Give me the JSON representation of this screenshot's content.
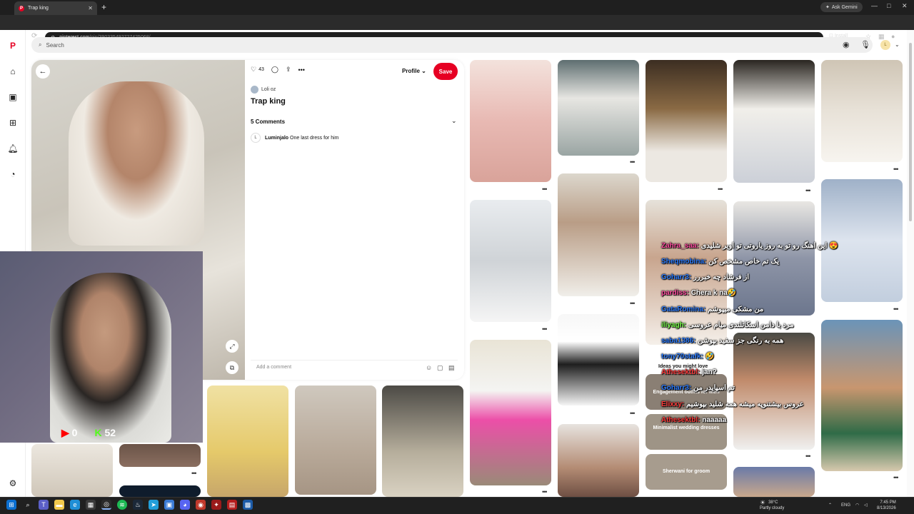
{
  "browser": {
    "tab_title": "Trap king",
    "url_host": "pinterest.com",
    "url_path": "/pin/390335492727425068/",
    "ask_gemini": "Ask Gemini",
    "install": "Install"
  },
  "search": {
    "placeholder": "Search"
  },
  "account": {
    "initial": "L"
  },
  "pin": {
    "likes": "43",
    "profile_label": "Profile",
    "save_label": "Save",
    "author": "Loli oz",
    "title": "Trap king",
    "comments_header": "5 Comments",
    "first_comment": {
      "user": "Luminjalo",
      "text": "One last dress for him",
      "initial": "L"
    },
    "add_comment_placeholder": "Add a comment"
  },
  "grid": {
    "labels": {
      "ideas": "Ideas you might love",
      "engagement": "Engagement outfits for men",
      "minimalist": "Minimalist wedding dresses",
      "sherwani": "Sherwani for groom"
    }
  },
  "stream": {
    "youtube_count": "0",
    "kick_count": "52",
    "chat": [
      {
        "user": "Zahra_saa:",
        "msg": "این اهنگ رو تو به روز یاروتی تو اویر شلیدی 😍"
      },
      {
        "user": "Sheqmobina:",
        "msg": "یک تم خاص مشخص کن"
      },
      {
        "user": "Goharr3:",
        "msg": "از فرشاد چه خبررر"
      },
      {
        "user": "pardiss:",
        "msg": "Chera k na🤣"
      },
      {
        "user": "GataRomina:",
        "msg": "من مشکی میپوشم"
      },
      {
        "user": "iliyagh:",
        "msg": "مرد با دامن اسکاتلندی میام عروسی"
      },
      {
        "user": "saba1386:",
        "msg": "همه به رنگی جز سفید بپوشن"
      },
      {
        "user": "tony70stafk:",
        "msg": "🤣"
      },
      {
        "user": "Athesektbl:",
        "msg": "jan?"
      },
      {
        "user": "Goharr3:",
        "msg": "تم اسپایدر من"
      },
      {
        "user": "Elixxy:",
        "msg": "عروس بیشتنوپه میشه همه شلید بپوشیم"
      },
      {
        "user": "Athesektbl:",
        "msg": "naaaaa"
      }
    ]
  },
  "taskbar": {
    "weather_temp": "38°C",
    "weather_desc": "Partly cloudy",
    "lang": "ENG",
    "time": "7:45 PM",
    "date": "8/13/2026"
  }
}
